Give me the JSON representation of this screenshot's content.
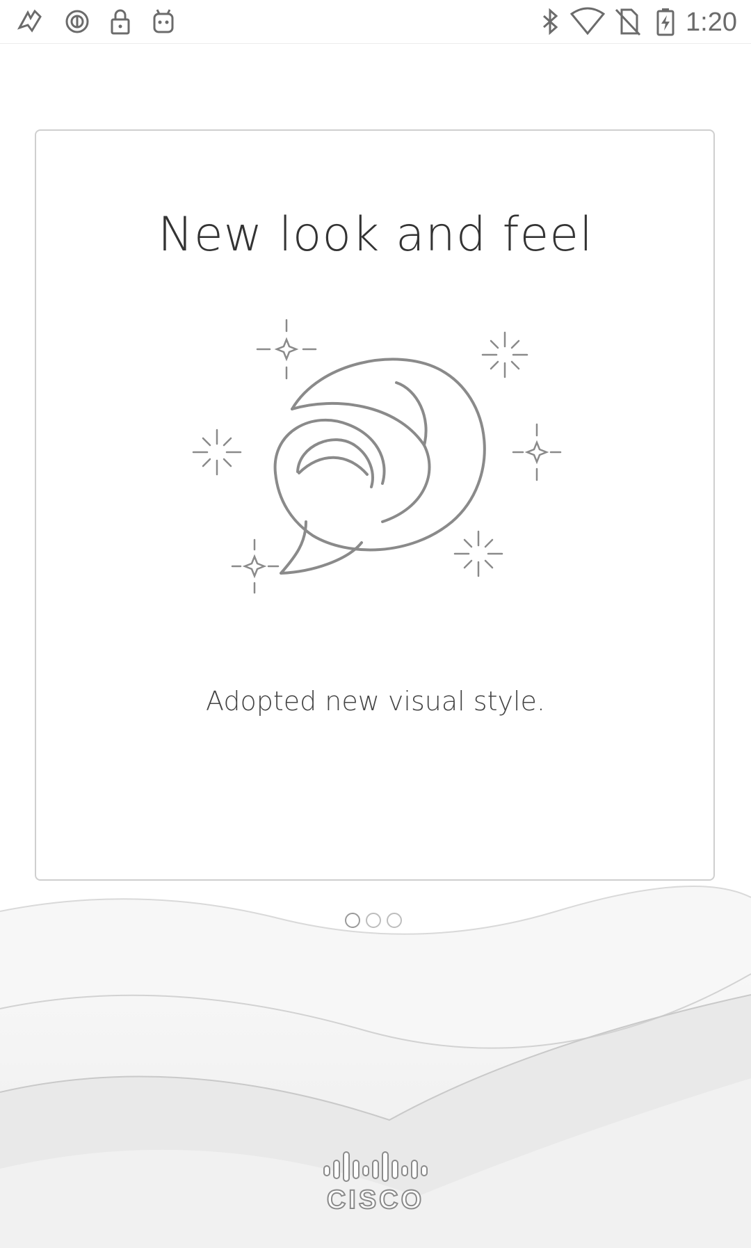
{
  "status_bar": {
    "time": "1:20",
    "left_icons": [
      "accessibility-icon",
      "data-saver-icon",
      "lock-icon",
      "android-icon"
    ],
    "right_icons": [
      "bluetooth-icon",
      "wifi-icon",
      "no-sim-icon",
      "battery-charging-icon"
    ]
  },
  "card": {
    "title": "New look and feel",
    "subtitle": "Adopted new visual style.",
    "illustration": "chat-bubble-sparkles-illustration"
  },
  "pager": {
    "count": 3,
    "active_index": 0
  },
  "brand": {
    "name": "CISCO"
  }
}
